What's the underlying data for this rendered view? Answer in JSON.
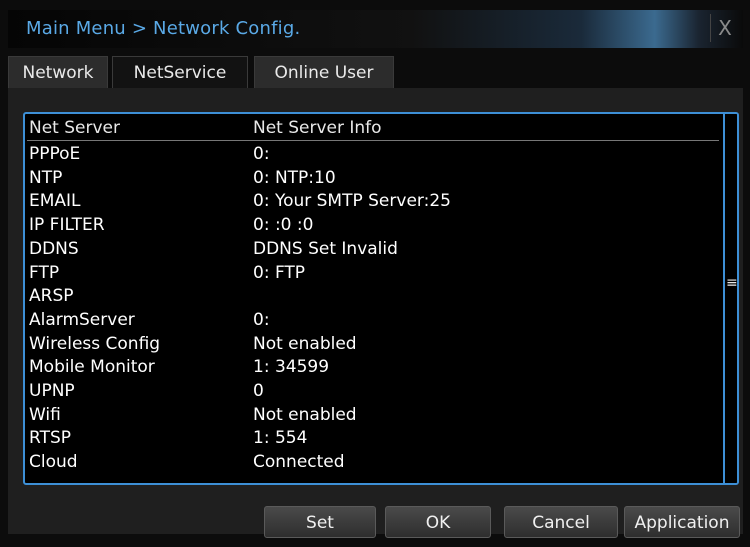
{
  "window": {
    "title": "Main Menu > Network Config.",
    "close_glyph": "X"
  },
  "tabs": [
    {
      "label": "Network",
      "active": false
    },
    {
      "label": "NetService",
      "active": true
    },
    {
      "label": "Online User",
      "active": false
    }
  ],
  "table": {
    "columns": [
      "Net Server",
      "Net Server Info"
    ],
    "rows": [
      {
        "server": "PPPoE",
        "info": "0:"
      },
      {
        "server": "NTP",
        "info": "0: NTP:10"
      },
      {
        "server": "EMAIL",
        "info": "0: Your SMTP Server:25"
      },
      {
        "server": "IP FILTER",
        "info": "0: :0 :0"
      },
      {
        "server": "DDNS",
        "info": "DDNS Set Invalid"
      },
      {
        "server": "FTP",
        "info": "0: FTP"
      },
      {
        "server": "ARSP",
        "info": ""
      },
      {
        "server": "AlarmServer",
        "info": "0:"
      },
      {
        "server": "Wireless Config",
        "info": "Not enabled"
      },
      {
        "server": "Mobile Monitor",
        "info": "1: 34599"
      },
      {
        "server": "UPNP",
        "info": "0"
      },
      {
        "server": "Wifi",
        "info": "Not enabled"
      },
      {
        "server": "RTSP",
        "info": "1: 554"
      },
      {
        "server": "Cloud",
        "info": "Connected"
      }
    ],
    "scroll_thumb_glyph": "≡"
  },
  "buttons": {
    "set": "Set",
    "ok": "OK",
    "cancel": "Cancel",
    "application": "Application"
  },
  "colors": {
    "title": "#5aa9e6",
    "accent_border": "#3d8fd6"
  }
}
